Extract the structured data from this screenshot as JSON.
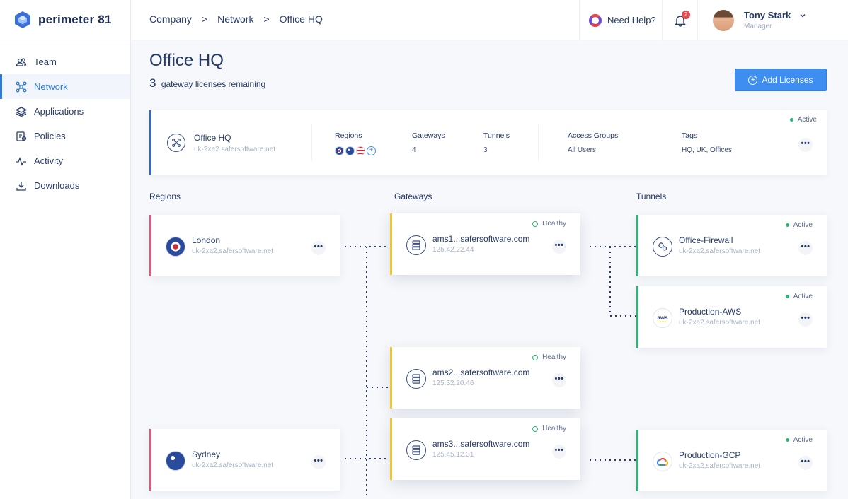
{
  "app": {
    "logo_text": "perimeter 81"
  },
  "sidebar": {
    "items": [
      {
        "label": "Team",
        "icon": "team-icon"
      },
      {
        "label": "Network",
        "icon": "network-icon",
        "active": true
      },
      {
        "label": "Applications",
        "icon": "applications-icon"
      },
      {
        "label": "Policies",
        "icon": "policies-icon"
      },
      {
        "label": "Activity",
        "icon": "activity-icon"
      },
      {
        "label": "Downloads",
        "icon": "download-icon"
      }
    ]
  },
  "topbar": {
    "breadcrumbs": [
      "Company",
      "Network",
      "Office HQ"
    ],
    "breadcrumb_sep": ">",
    "help_label": "Need Help?",
    "notification_count": "2",
    "user": {
      "name": "Tony Stark",
      "role": "Manager"
    }
  },
  "page": {
    "title": "Office HQ",
    "licenses_count": "3",
    "licenses_text": "gateway licenses remaining",
    "add_button": "Add Licenses"
  },
  "summary": {
    "name": "Office HQ",
    "host": "uk-2xa2.safersoftware.net",
    "status": "Active",
    "regions_label": "Regions",
    "region_flags": [
      "uk-flag",
      "australia-flag",
      "us-flag",
      "add-region"
    ],
    "gateways_label": "Gateways",
    "gateways_value": "4",
    "tunnels_label": "Tunnels",
    "tunnels_value": "3",
    "access_groups_label": "Access Groups",
    "access_groups_value": "All Users",
    "tags_label": "Tags",
    "tags_value": "HQ, UK, Offices",
    "more": "•••"
  },
  "sections": {
    "regions": "Regions",
    "gateways": "Gateways",
    "tunnels": "Tunnels"
  },
  "regions": [
    {
      "name": "London",
      "host": "uk-2xa2.safersoftware.net",
      "flag": "uk-flag",
      "more": "•••"
    },
    {
      "name": "Sydney",
      "host": "uk-2xa2.safersoftware.net",
      "flag": "australia-flag",
      "more": "•••"
    }
  ],
  "gateways": [
    {
      "name": "ams1...safersoftware.com",
      "ip": "125.42.22.44",
      "status": "Healthy",
      "more": "•••"
    },
    {
      "name": "ams2...safersoftware.com",
      "ip": "125.32.20.46",
      "status": "Healthy",
      "more": "•••"
    },
    {
      "name": "ams3...safersoftware.com",
      "ip": "125.45.12.31",
      "status": "Healthy",
      "more": "•••"
    }
  ],
  "tunnels": [
    {
      "name": "Office-Firewall",
      "host": "uk-2xa2.safersoftware.net",
      "status": "Active",
      "icon": "firewall-icon",
      "more": "•••"
    },
    {
      "name": "Production-AWS",
      "host": "uk-2xa2.safersoftware.net",
      "status": "Active",
      "icon": "aws-logo-icon",
      "logo_text": "aws",
      "more": "•••"
    },
    {
      "name": "Production-GCP",
      "host": "uk-2xa2.safersoftware.net",
      "status": "Active",
      "icon": "gcp-logo-icon",
      "more": "•••"
    }
  ],
  "colors": {
    "accent": "#3d8ef0",
    "region_border": "#e2577a",
    "gateway_border": "#f4c430",
    "tunnel_border": "#2bb673",
    "summary_border": "#3565c9"
  }
}
